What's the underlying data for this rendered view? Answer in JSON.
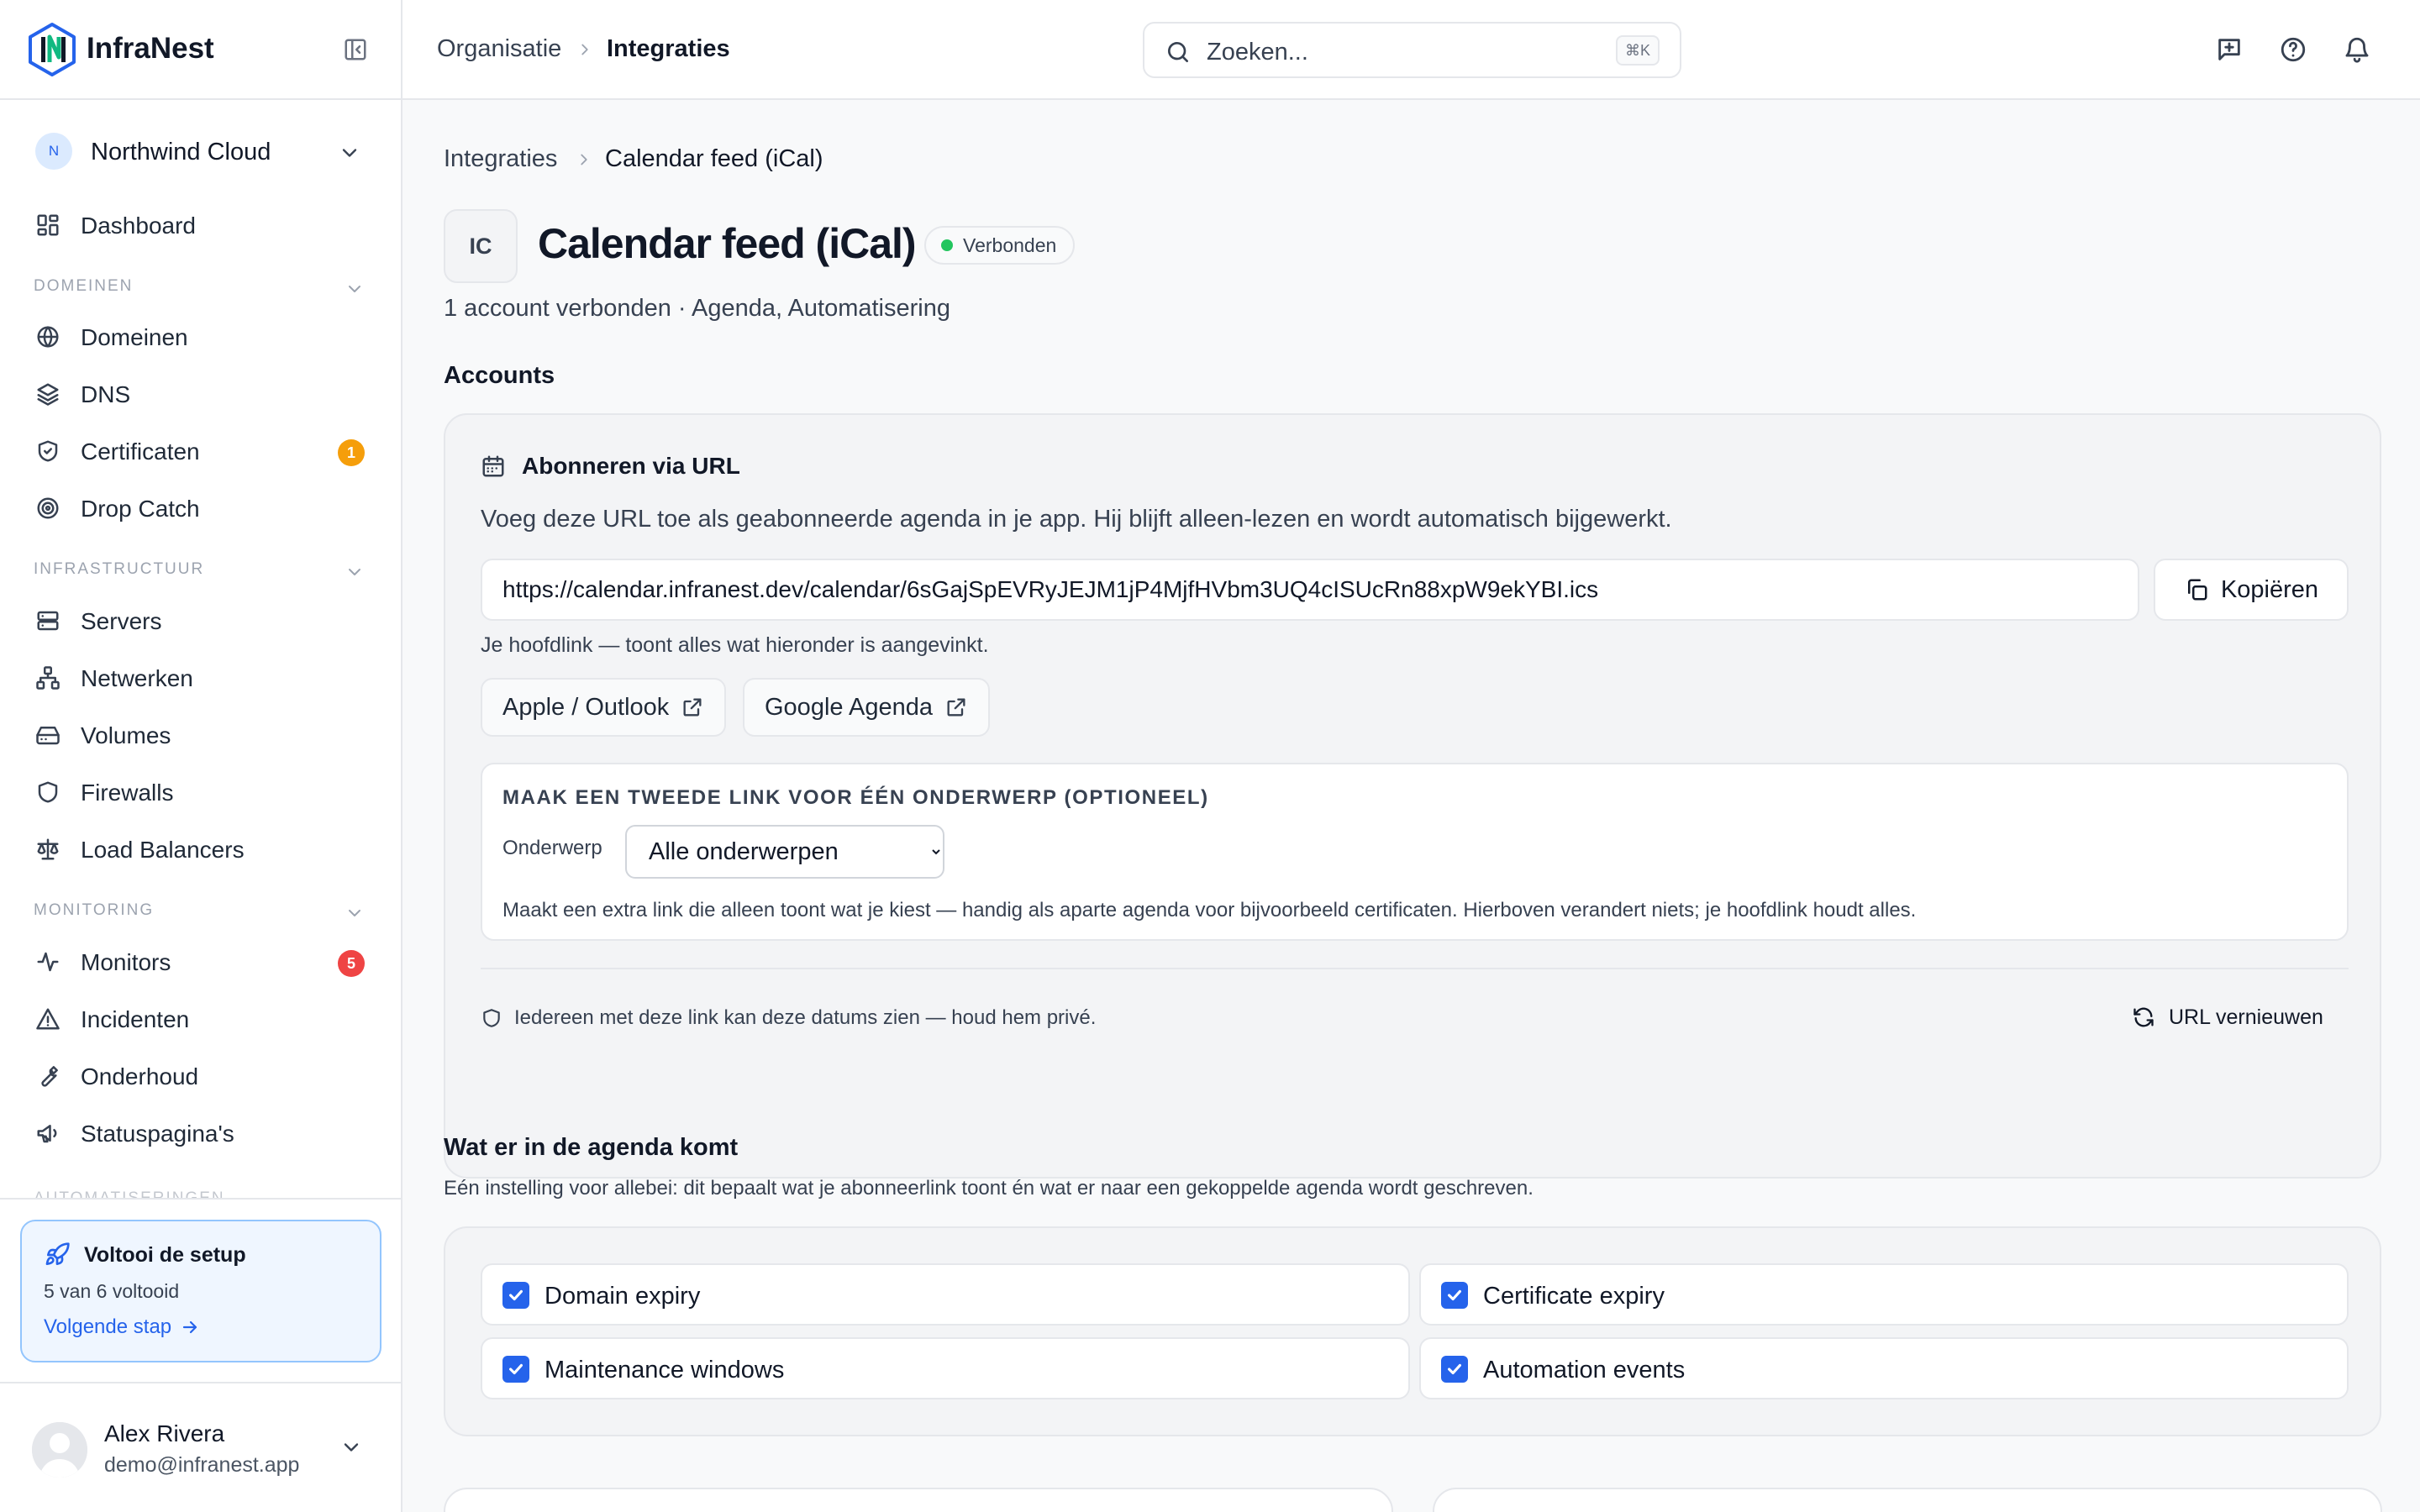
{
  "brand": {
    "name": "InfraNest"
  },
  "org": {
    "initial": "N",
    "name": "Northwind Cloud"
  },
  "nav": {
    "dashboard": "Dashboard",
    "sections": {
      "domains": "DOMEINEN",
      "infra": "INFRASTRUCTUUR",
      "monitoring": "MONITORING",
      "automation": "AUTOMATISERINGEN"
    },
    "items": {
      "domeinen": "Domeinen",
      "dns": "DNS",
      "certificaten": "Certificaten",
      "dropcatch": "Drop Catch",
      "servers": "Servers",
      "netwerken": "Netwerken",
      "volumes": "Volumes",
      "firewalls": "Firewalls",
      "loadbalancers": "Load Balancers",
      "monitors": "Monitors",
      "incidenten": "Incidenten",
      "onderhoud": "Onderhoud",
      "statuspaginas": "Statuspagina's"
    },
    "badges": {
      "certificaten": "1",
      "monitors": "5"
    }
  },
  "setup": {
    "title": "Voltooi de setup",
    "progress": "5 van 6 voltooid",
    "next": "Volgende stap"
  },
  "user": {
    "name": "Alex Rivera",
    "email": "demo@infranest.app"
  },
  "topbar": {
    "breadcrumb": [
      "Organisatie",
      "Integraties"
    ],
    "search_placeholder": "Zoeken...",
    "shortcut": "⌘K"
  },
  "page": {
    "breadcrumb": [
      "Integraties",
      "Calendar feed (iCal)"
    ],
    "icon_text": "IC",
    "title": "Calendar feed (iCal)",
    "status": "Verbonden",
    "subtitle": "1 account verbonden · Agenda, Automatisering",
    "accounts_heading": "Accounts"
  },
  "subscribe": {
    "title": "Abonneren via URL",
    "description": "Voeg deze URL toe als geabonneerde agenda in je app. Hij blijft alleen-lezen en wordt automatisch bijgewerkt.",
    "url": "https://calendar.infranest.dev/calendar/6sGajSpEVRyJEJM1jP4MjfHVbm3UQ4cISUcRn88xpW9ekYBI.ics",
    "copy_label": "Kopiëren",
    "hint": "Je hoofdlink — toont alles wat hieronder is aangevinkt.",
    "apple_label": "Apple / Outlook",
    "google_label": "Google Agenda",
    "second_link": {
      "heading": "MAAK EEN TWEEDE LINK VOOR ÉÉN ONDERWERP (OPTIONEEL)",
      "label": "Onderwerp",
      "selected": "Alle onderwerpen",
      "note": "Maakt een extra link die alleen toont wat je kiest — handig als aparte agenda voor bijvoorbeeld certificaten. Hierboven verandert niets; je hoofdlink houdt alles."
    },
    "privacy": "Iedereen met deze link kan deze datums zien — houd hem privé.",
    "renew_label": "URL vernieuwen"
  },
  "agenda": {
    "heading": "Wat er in de agenda komt",
    "description": "Eén instelling voor allebei: dit bepaalt wat je abonneerlink toont én wat er naar een gekoppelde agenda wordt geschreven.",
    "options": [
      "Domain expiry",
      "Certificate expiry",
      "Maintenance windows",
      "Automation events"
    ]
  },
  "colors": {
    "accent": "#2563eb",
    "success": "#22c55e",
    "warning": "#f59e0b",
    "danger": "#ef4444"
  }
}
